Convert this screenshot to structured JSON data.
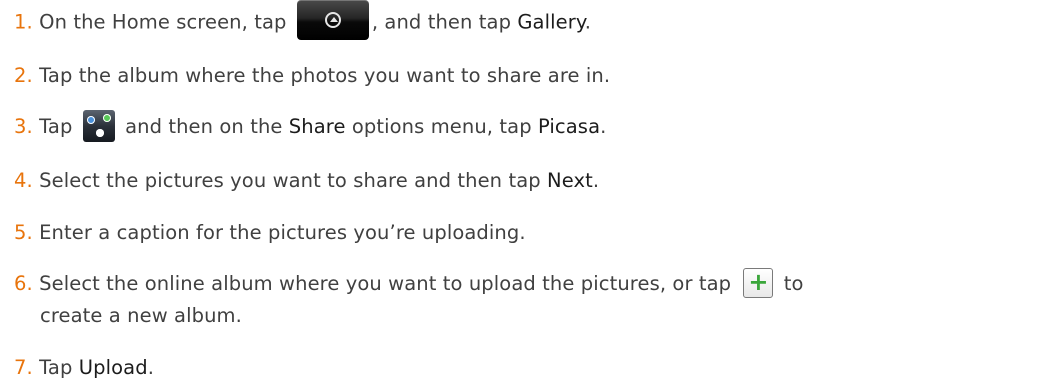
{
  "steps": [
    {
      "num": "1.",
      "t1": "On the Home screen, tap",
      "icon": "home-all-apps-button-icon",
      "t2": ", and then tap ",
      "e1": "Gallery",
      "t3": "."
    },
    {
      "num": "2.",
      "t1": "Tap the album where the photos you want to share are in."
    },
    {
      "num": "3.",
      "t1": "Tap",
      "icon": "share-icon",
      "t2": "and then on the ",
      "e1": "Share",
      "t3": " options menu, tap ",
      "e2": "Picasa",
      "t4": "."
    },
    {
      "num": "4.",
      "t1": "Select the pictures you want to share and then tap ",
      "e1": "Next",
      "t2": "."
    },
    {
      "num": "5.",
      "t1": "Enter a caption for the pictures you’re uploading."
    },
    {
      "num": "6.",
      "t1": "Select the online album where you want to upload the pictures, or tap",
      "icon": "add-album-plus-icon",
      "t2": "to",
      "cont": "create a new album."
    },
    {
      "num": "7.",
      "t1": "Tap ",
      "e1": "Upload",
      "t2": "."
    }
  ],
  "colors": {
    "number": "#e8740c",
    "text": "#404040",
    "emphasis": "#1c1c1c",
    "plus": "#3aa63a"
  }
}
